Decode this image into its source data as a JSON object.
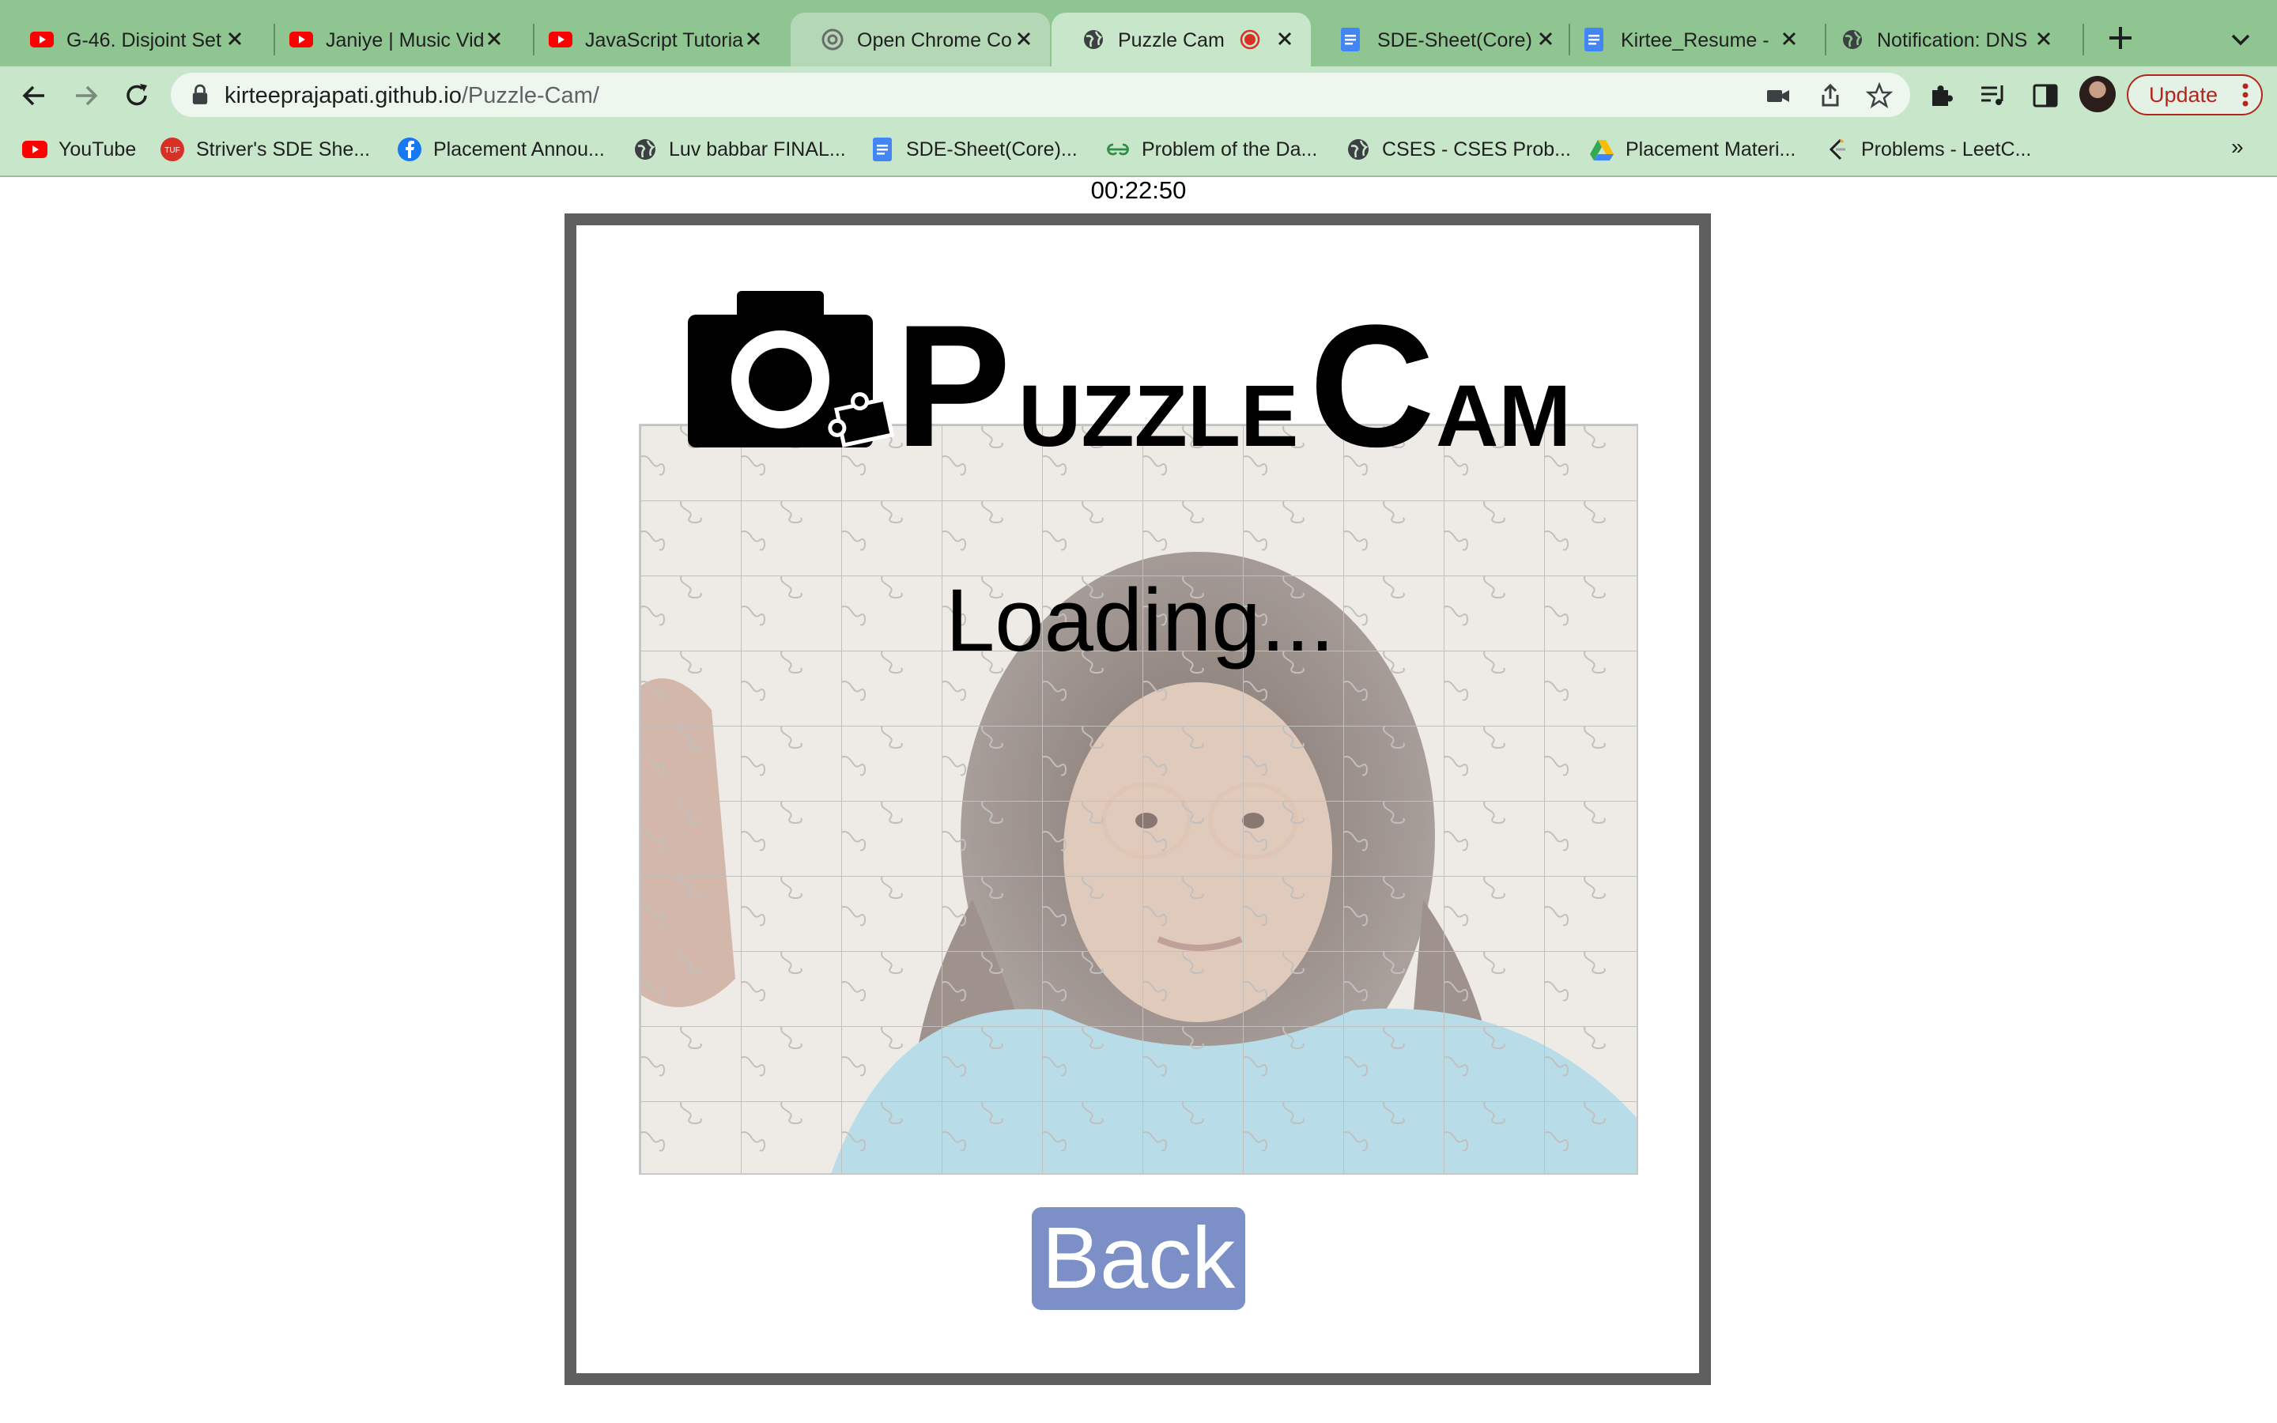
{
  "browser": {
    "tabs": [
      {
        "title": "G-46. Disjoint Set",
        "favicon": "youtube-icon"
      },
      {
        "title": "Janiye | Music Vid",
        "favicon": "youtube-icon"
      },
      {
        "title": "JavaScript Tutoria",
        "favicon": "youtube-icon"
      },
      {
        "title": "Open Chrome Co",
        "favicon": "openai-icon"
      },
      {
        "title": "Puzzle Cam",
        "favicon": "globe-icon",
        "active": true,
        "recording": true
      },
      {
        "title": "SDE-Sheet(Core)",
        "favicon": "docs-icon"
      },
      {
        "title": "Kirtee_Resume -",
        "favicon": "docs-icon"
      },
      {
        "title": "Notification: DNS",
        "favicon": "globe-icon"
      }
    ],
    "address": {
      "host": "kirteeprajapati.github.io",
      "path": "/Puzzle-Cam/"
    },
    "update_label": "Update",
    "bookmarks": [
      {
        "label": "YouTube",
        "icon": "youtube-icon"
      },
      {
        "label": "Striver's SDE She...",
        "icon": "tuf-icon"
      },
      {
        "label": "Placement Annou...",
        "icon": "facebook-icon"
      },
      {
        "label": "Luv babbar FINAL...",
        "icon": "globe-icon"
      },
      {
        "label": "SDE-Sheet(Core)...",
        "icon": "docs-icon"
      },
      {
        "label": "Problem of the Da...",
        "icon": "gfg-icon"
      },
      {
        "label": "CSES - CSES Prob...",
        "icon": "globe-icon"
      },
      {
        "label": "Placement Materi...",
        "icon": "drive-icon"
      },
      {
        "label": "Problems - LeetC...",
        "icon": "leetcode-icon"
      }
    ],
    "bookmarks_more": "»",
    "colors": {
      "frame": "#8fc591",
      "toolbar": "#c8e6c9",
      "update": "#b3261e"
    }
  },
  "page": {
    "timer": "00:22:50",
    "logo_text": "PuzzleCam",
    "status": "Loading...",
    "back_label": "Back",
    "colors": {
      "back_button": "#7c8fc7",
      "frame_border": "#5f5f5f"
    }
  }
}
